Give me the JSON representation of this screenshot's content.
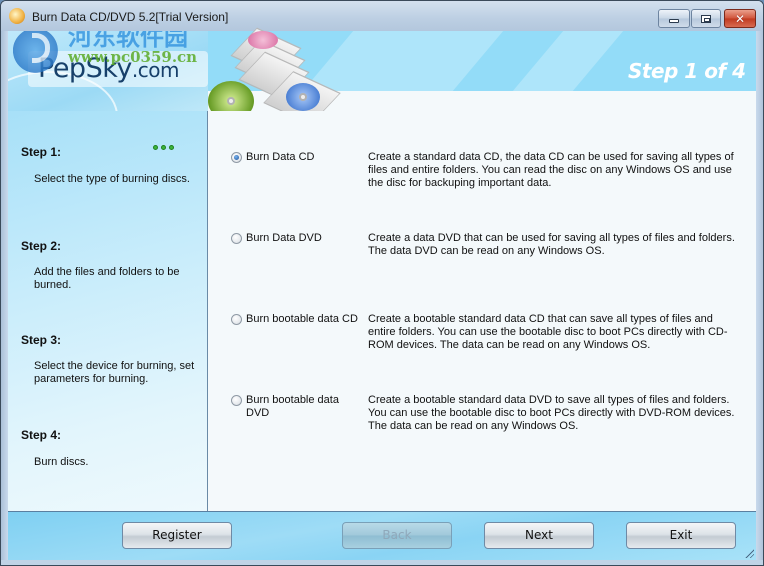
{
  "window": {
    "title": "Burn Data CD/DVD 5.2[Trial Version]",
    "controls": {
      "minimize": "minimize",
      "maximize": "maximize",
      "close": "close"
    }
  },
  "header": {
    "logo_main": "PepSky",
    "logo_suffix": ".com",
    "watermark_cn": "河东软件园",
    "watermark_url": "www.pc0359.cn",
    "step_title": "Step 1 of 4"
  },
  "steps": [
    {
      "label": "Step 1:",
      "description": "Select the type of burning discs."
    },
    {
      "label": "Step 2:",
      "description": "Add the files and folders to be burned."
    },
    {
      "label": "Step 3:",
      "description": "Select the device for burning, set parameters for burning."
    },
    {
      "label": "Step 4:",
      "description": "Burn discs."
    }
  ],
  "current_step": 1,
  "current_step_progress_dots": 3,
  "options": [
    {
      "label": "Burn Data CD",
      "checked": true,
      "description": "Create a standard data CD, the data CD can be used for saving all types of files and entire folders. You can read the disc on any Windows OS and use the disc for backuping important data."
    },
    {
      "label": "Burn Data DVD",
      "checked": false,
      "description": "Create a data DVD that can be used for saving all types of files and folders. The data DVD can be read on any Windows OS."
    },
    {
      "label": "Burn bootable data CD",
      "checked": false,
      "description": "Create a bootable standard data CD that can save all types of files and entire folders. You can use the bootable disc to boot PCs directly with CD-ROM devices. The data can be read on any Windows OS."
    },
    {
      "label": "Burn bootable data DVD",
      "checked": false,
      "description": "Create a bootable standard data DVD to save all types of files and folders. You can use the bootable disc to boot PCs directly with DVD-ROM devices. The data can be read on any Windows OS."
    }
  ],
  "footer": {
    "register_label": "Register",
    "back_label": "Back",
    "back_enabled": false,
    "next_label": "Next",
    "exit_label": "Exit"
  },
  "colors": {
    "banner": "#93dcf8",
    "step_dots": "#3cb43c",
    "close_button": "#c03a20"
  }
}
